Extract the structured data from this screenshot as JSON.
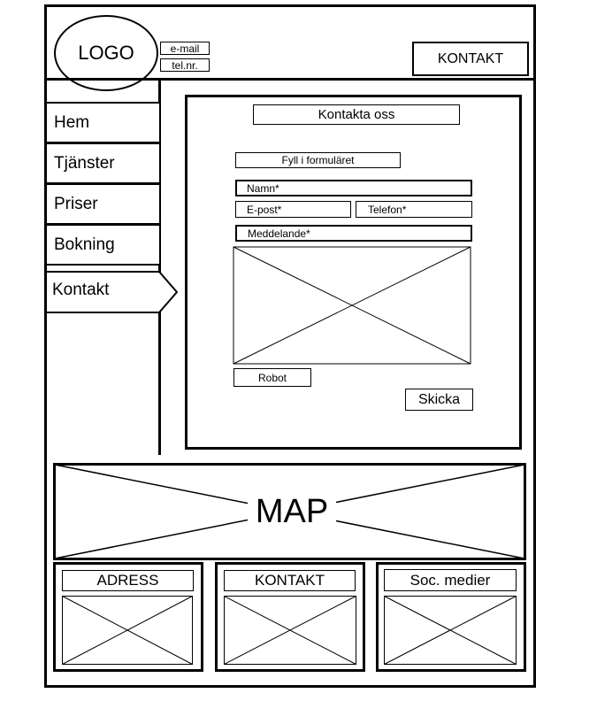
{
  "header": {
    "logo": "LOGO",
    "email": "e-mail",
    "phone": "tel.nr.",
    "contact_button": "KONTAKT"
  },
  "nav": {
    "items": [
      {
        "label": "Hem"
      },
      {
        "label": "Tjänster"
      },
      {
        "label": "Priser"
      },
      {
        "label": "Bokning"
      },
      {
        "label": "Kontakt",
        "active": true
      }
    ]
  },
  "form": {
    "title": "Kontakta oss",
    "subtitle": "Fyll i formuläret",
    "name_placeholder": "Namn*",
    "email_placeholder": "E-post*",
    "phone_placeholder": "Telefon*",
    "message_label": "Meddelande*",
    "robot_label": "Robot",
    "submit_label": "Skicka"
  },
  "map": {
    "label": "MAP"
  },
  "footer": {
    "columns": [
      {
        "title": "ADRESS"
      },
      {
        "title": "KONTAKT"
      },
      {
        "title": "Soc. medier"
      }
    ]
  }
}
